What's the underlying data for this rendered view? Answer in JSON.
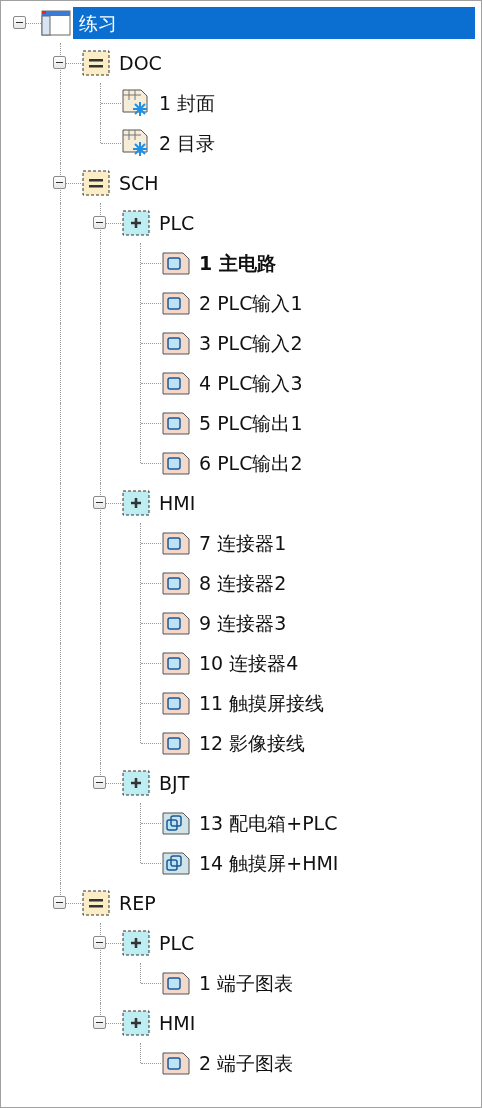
{
  "tree": [
    {
      "label": "练习",
      "kind": "project",
      "expanded": true,
      "selected": true,
      "children": [
        {
          "label": "DOC",
          "kind": "group",
          "expanded": true,
          "selected": false,
          "children": [
            {
              "label": "1 封面",
              "kind": "cover",
              "selected": false,
              "current": false
            },
            {
              "label": "2 目录",
              "kind": "cover",
              "selected": false,
              "current": false
            }
          ]
        },
        {
          "label": "SCH",
          "kind": "group",
          "expanded": true,
          "selected": false,
          "children": [
            {
              "label": "PLC",
              "kind": "subgroup",
              "expanded": true,
              "selected": false,
              "children": [
                {
                  "label": "1 主电路",
                  "kind": "schematic",
                  "selected": false,
                  "current": true
                },
                {
                  "label": "2 PLC输入1",
                  "kind": "schematic",
                  "selected": false,
                  "current": false
                },
                {
                  "label": "3 PLC输入2",
                  "kind": "schematic",
                  "selected": false,
                  "current": false
                },
                {
                  "label": "4 PLC输入3",
                  "kind": "schematic",
                  "selected": false,
                  "current": false
                },
                {
                  "label": "5 PLC输出1",
                  "kind": "schematic",
                  "selected": false,
                  "current": false
                },
                {
                  "label": "6 PLC输出2",
                  "kind": "schematic",
                  "selected": false,
                  "current": false
                }
              ]
            },
            {
              "label": "HMI",
              "kind": "subgroup",
              "expanded": true,
              "selected": false,
              "children": [
                {
                  "label": "7 连接器1",
                  "kind": "schematic",
                  "selected": false,
                  "current": false
                },
                {
                  "label": "8 连接器2",
                  "kind": "schematic",
                  "selected": false,
                  "current": false
                },
                {
                  "label": "9 连接器3",
                  "kind": "schematic",
                  "selected": false,
                  "current": false
                },
                {
                  "label": "10 连接器4",
                  "kind": "schematic",
                  "selected": false,
                  "current": false
                },
                {
                  "label": "11 触摸屏接线",
                  "kind": "schematic",
                  "selected": false,
                  "current": false
                },
                {
                  "label": "12 影像接线",
                  "kind": "schematic",
                  "selected": false,
                  "current": false
                }
              ]
            },
            {
              "label": "BJT",
              "kind": "subgroup",
              "expanded": true,
              "selected": false,
              "children": [
                {
                  "label": "13 配电箱+PLC",
                  "kind": "layout",
                  "selected": false,
                  "current": false
                },
                {
                  "label": "14 触摸屏+HMI",
                  "kind": "layout",
                  "selected": false,
                  "current": false
                }
              ]
            }
          ]
        },
        {
          "label": "REP",
          "kind": "group",
          "expanded": true,
          "selected": false,
          "children": [
            {
              "label": "PLC",
              "kind": "subgroup",
              "expanded": true,
              "selected": false,
              "children": [
                {
                  "label": "1 端子图表",
                  "kind": "schematic",
                  "selected": false,
                  "current": false
                }
              ]
            },
            {
              "label": "HMI",
              "kind": "subgroup",
              "expanded": true,
              "selected": false,
              "children": [
                {
                  "label": "2 端子图表",
                  "kind": "schematic",
                  "selected": false,
                  "current": false
                }
              ]
            }
          ]
        }
      ]
    }
  ]
}
